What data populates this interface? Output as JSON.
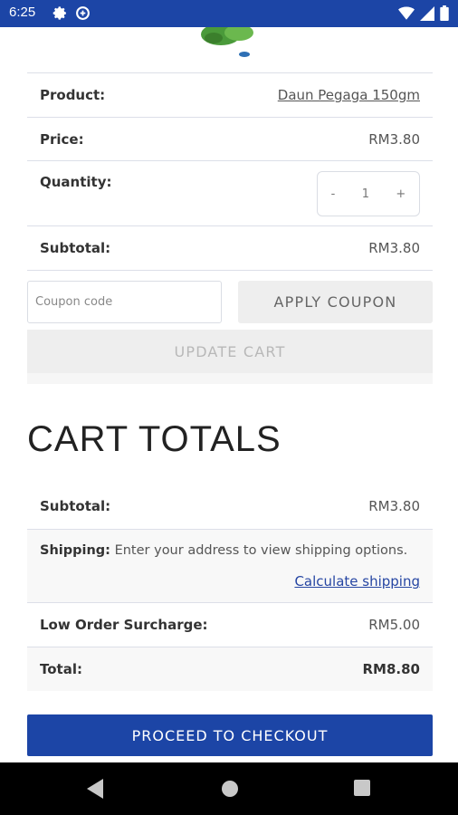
{
  "status_bar": {
    "time": "6:25",
    "icons": [
      "settings-icon",
      "data-saver-icon",
      "wifi-icon",
      "signal-icon",
      "battery-icon"
    ]
  },
  "cart_item": {
    "product_label": "Product:",
    "product_name": "Daun Pegaga 150gm",
    "price_label": "Price:",
    "price": "RM3.80",
    "quantity_label": "Quantity:",
    "quantity_minus": "-",
    "quantity_value": "1",
    "quantity_plus": "+",
    "subtotal_label": "Subtotal:",
    "subtotal": "RM3.80"
  },
  "coupon": {
    "placeholder": "Coupon code",
    "apply_label": "APPLY COUPON",
    "update_label": "UPDATE CART"
  },
  "totals": {
    "title": "CART TOTALS",
    "subtotal_label": "Subtotal:",
    "subtotal": "RM3.80",
    "shipping_label": "Shipping:",
    "shipping_text": "Enter your address to view shipping options.",
    "calculate_link": "Calculate shipping",
    "surcharge_label": "Low Order Surcharge:",
    "surcharge": "RM5.00",
    "total_label": "Total:",
    "total": "RM8.80"
  },
  "checkout": {
    "label": "PROCEED TO CHECKOUT"
  },
  "colors": {
    "brand": "#1c45a6",
    "link": "#2646a3"
  }
}
